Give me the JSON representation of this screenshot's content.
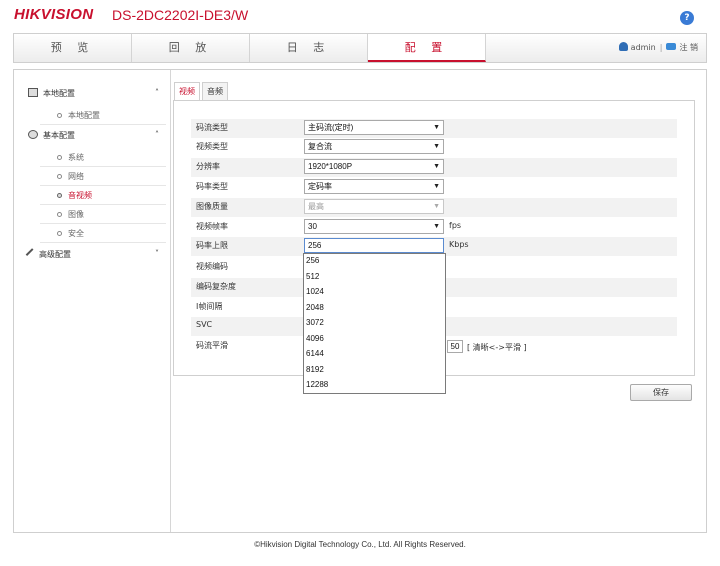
{
  "header": {
    "brand": "HIKVISION",
    "model": "DS-2DC2202I-DE3/W",
    "help_icon": "?"
  },
  "nav": {
    "tabs": [
      "预 览",
      "回 放",
      "日 志",
      "配 置"
    ],
    "active_tab": "配 置",
    "user": "admin",
    "separator": "|",
    "logout": "注 销"
  },
  "sidebar": {
    "groups": [
      {
        "label": "本地配置",
        "chevron": "˄",
        "items": [
          "本地配置"
        ]
      },
      {
        "label": "基本配置",
        "chevron": "˄",
        "items": [
          "系统",
          "网络",
          "音视频",
          "图像",
          "安全"
        ]
      },
      {
        "label": "高级配置",
        "chevron": "˅",
        "items": []
      }
    ],
    "active_item": "音视频"
  },
  "subtabs": [
    "视频",
    "音频"
  ],
  "form": {
    "rows": [
      {
        "label": "码流类型",
        "value": "主码流(定时)"
      },
      {
        "label": "视频类型",
        "value": "复合流"
      },
      {
        "label": "分辨率",
        "value": "1920*1080P"
      },
      {
        "label": "码率类型",
        "value": "定码率"
      },
      {
        "label": "图像质量",
        "value": "最高"
      },
      {
        "label": "视频帧率",
        "value": "30",
        "unit": "fps"
      },
      {
        "label": "码率上限",
        "value": "256",
        "unit": "Kbps"
      },
      {
        "label": "视频编码"
      },
      {
        "label": "编码复杂度"
      },
      {
        "label": "I帧间隔"
      },
      {
        "label": "SVC"
      },
      {
        "label": "码流平滑"
      }
    ],
    "smoothing_value": "50",
    "smoothing_hint": "[ 清晰<->平滑 ]"
  },
  "bitrate_dropdown": {
    "options": [
      "256",
      "512",
      "1024",
      "2048",
      "3072",
      "4096",
      "6144",
      "8192",
      "12288"
    ]
  },
  "save_label": "保存",
  "footer": "©Hikvision Digital Technology Co., Ltd. All Rights Reserved.",
  "colors": {
    "brand": "#c8102e",
    "accent": "#3a7bd5"
  }
}
